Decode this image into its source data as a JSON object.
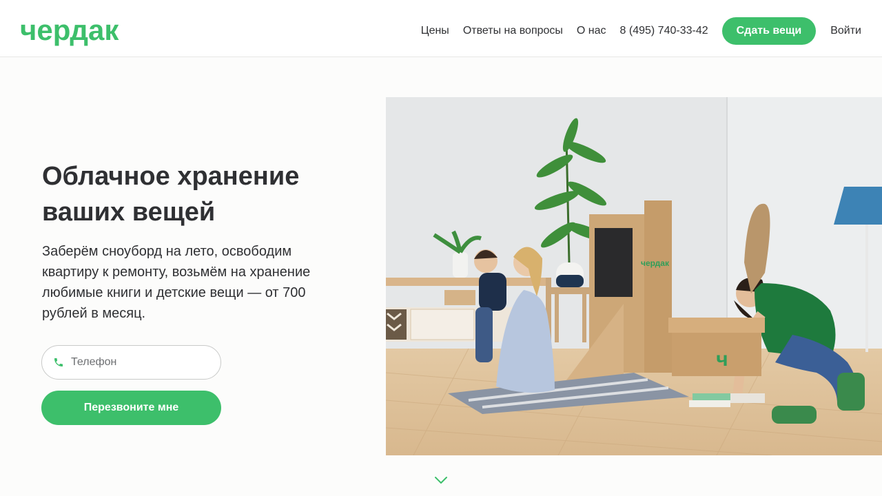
{
  "header": {
    "logo": "чердак",
    "nav": [
      {
        "label": "Цены"
      },
      {
        "label": "Ответы на вопросы"
      },
      {
        "label": "О нас"
      },
      {
        "label": "8 (495) 740-33-42"
      }
    ],
    "cta_label": "Сдать вещи",
    "login_label": "Войти"
  },
  "hero": {
    "title": "Облачное хранение ваших вещей",
    "subtitle": "Заберём сноуборд на лето, освободим квартиру к ремонту, возьмём на хранение любимые книги и детские вещи — от 700 рублей в месяц.",
    "phone_placeholder": "Телефон",
    "phone_value": "",
    "callback_label": "Перезвоните мне",
    "box_brand": "чердак"
  },
  "colors": {
    "accent": "#3dbf6b",
    "text": "#2f3033",
    "border": "#c9cac9"
  },
  "icons": {
    "phone": "phone-icon",
    "scroll": "chevron-down-icon"
  }
}
